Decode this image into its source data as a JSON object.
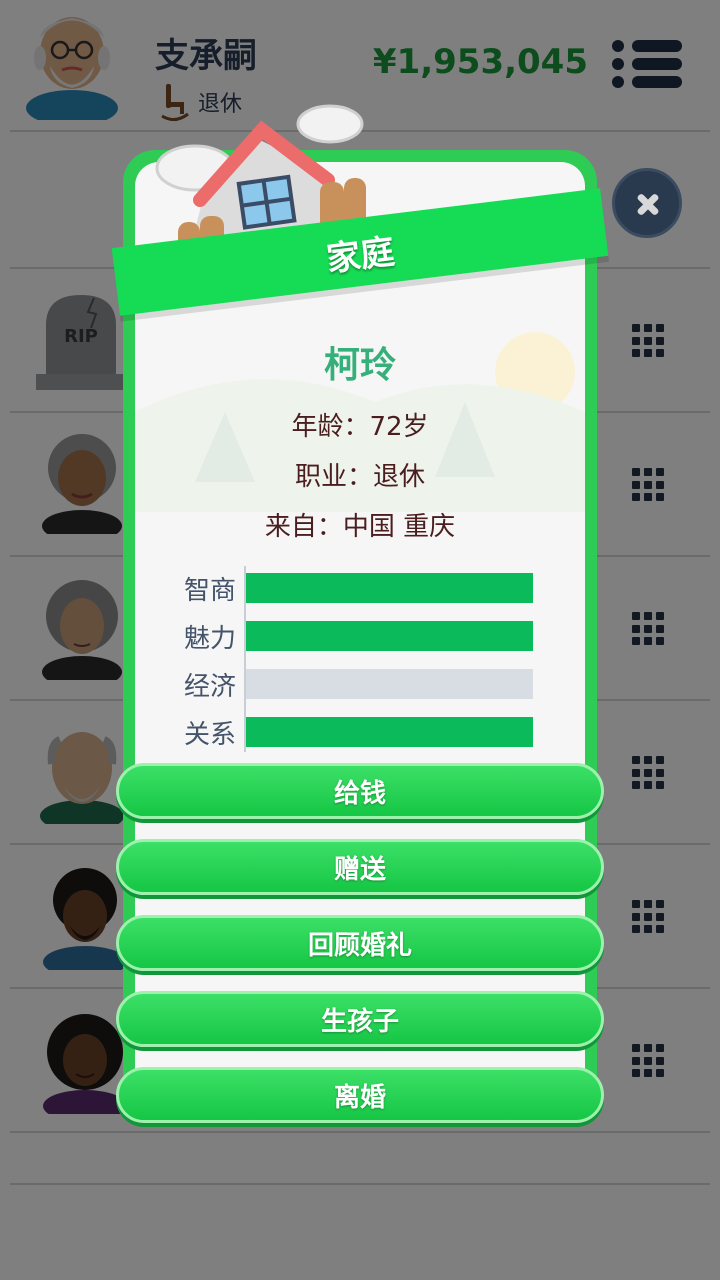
{
  "player": {
    "name": "支承嗣",
    "status": "退休",
    "money": "¥1,953,045"
  },
  "background_rows": [
    {
      "avatar": "tombstone",
      "label": "RIP"
    },
    {
      "avatar": "elderly-woman"
    },
    {
      "avatar": "elderly-woman-curly"
    },
    {
      "avatar": "elderly-man-bald"
    },
    {
      "avatar": "man-curly-hair"
    },
    {
      "avatar": "woman-curly-hair"
    }
  ],
  "dialog": {
    "title": "家庭",
    "member": {
      "name": "柯玲",
      "age_line": "年龄：72岁",
      "job_line": "职业：退休",
      "from_line": "来自：中国 重庆"
    },
    "stats": [
      {
        "label": "智商",
        "value": 1.0
      },
      {
        "label": "魅力",
        "value": 1.0
      },
      {
        "label": "经济",
        "value": 0.0
      },
      {
        "label": "关系",
        "value": 1.0
      }
    ],
    "actions": [
      {
        "label": "给钱"
      },
      {
        "label": "赠送"
      },
      {
        "label": "回顾婚礼"
      },
      {
        "label": "生孩子"
      },
      {
        "label": "离婚"
      }
    ]
  },
  "colors": {
    "accent_green": "#16dc55",
    "money_green": "#1a9a3a",
    "stat_fill": "#0bbb5b",
    "name_teal": "#35b07a"
  },
  "icons": [
    "rocking-chair-icon",
    "menu-icon",
    "close-icon",
    "grid-icon",
    "house-icon"
  ]
}
